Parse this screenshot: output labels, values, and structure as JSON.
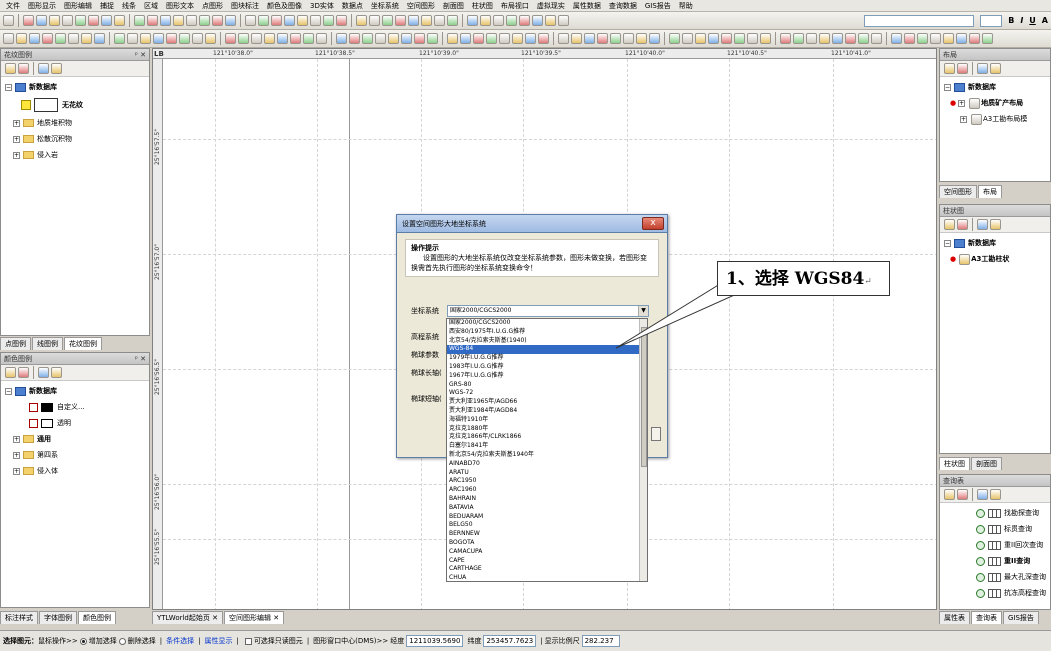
{
  "menu": [
    "文件",
    "图形显示",
    "图形编辑",
    "捕捉",
    "线条",
    "区域",
    "图形文本",
    "点图形",
    "图块标注",
    "颜色及图像",
    "3D实体",
    "数据点",
    "坐标系统",
    "空间图形",
    "剖面图",
    "柱状图",
    "布局视口",
    "虚拟现实",
    "属性数据",
    "查询数据",
    "GIS报告",
    "帮助"
  ],
  "format_toolbar": {
    "bold": "B",
    "italic": "I",
    "underline": "U",
    "font_color": "A"
  },
  "left_top_panel": {
    "title": "花纹图例",
    "root": "新数据库",
    "swatch_label": "无花纹",
    "folders": [
      "地质堆积物",
      "松散沉积物",
      "侵入岩"
    ],
    "tabs": [
      "点图例",
      "线图例",
      "花纹图例"
    ]
  },
  "left_bottom_panel": {
    "title": "颜色图例",
    "root": "新数据库",
    "items": [
      "自定义...",
      "透明"
    ],
    "folders": [
      "通用",
      "第四系",
      "侵入体"
    ],
    "tabs": [
      "标注样式",
      "字体图例",
      "颜色图例"
    ]
  },
  "doc_tabs": [
    "YTLWorld起始页",
    "空间图形编辑"
  ],
  "ruler_top": [
    "121°10'38.0\"",
    "121°10'38.5\"",
    "121°10'39.0\"",
    "121°10'39.5\"",
    "121°10'40.0\"",
    "121°10'40.5\"",
    "121°10'41.0\""
  ],
  "ruler_left": [
    "25°16'57.5\"",
    "25°16'57.0\"",
    "25°16'56.5\"",
    "25°16'56.0\"",
    "25°16'55.5\"",
    "25°16'55.0\""
  ],
  "corner_label": "LB",
  "dialog": {
    "title": "设置空间图形大地坐标系统",
    "close": "x",
    "hint_title": "操作提示",
    "hint_text": "设置图形的大地坐标系统仅改变坐标系统参数，图形未做变换，若图形变换需首先执行图形的坐标系统变换命令！",
    "labels": [
      "坐标系统",
      "高程系统",
      "椭球参数",
      "椭球长轴(",
      "椭球短轴("
    ],
    "selected": "国家2000/CGCS2000",
    "options": [
      "国家2000/CGCS2000",
      "西安80/1975年I.U.G.G推荐",
      "北京54/克拉索夫斯基(1940)",
      "WGS-84",
      "1979年I.U.G.G推荐",
      "1983年I.U.G.G推荐",
      "1967年I.U.G.G推荐",
      "GRS-80",
      "WGS-72",
      "贾大利亚1965年/AGD66",
      "贾大利亚1984年/AGD84",
      "海福特1910年",
      "克拉克1880年",
      "克拉克1866年/CLRK1866",
      "白塞尔1841年",
      "新北京54/克拉索夫斯基1940年",
      "AINABD70",
      "ARATU",
      "ARC1950",
      "ARC1960",
      "BAHRAIN",
      "BATAVIA",
      "BEDUARAM",
      "BELG50",
      "BERNNEW",
      "BOGOTA",
      "CAMACUPA",
      "CAPE",
      "CARTHAGE",
      "CHUA"
    ],
    "highlighted_index": 3
  },
  "callout": "1、选择 WGS84",
  "right_top_panel": {
    "title": "布局",
    "root": "新数据库",
    "items": [
      "地质矿产布局",
      "A3工勘布局模"
    ],
    "tabs": [
      "空间图形",
      "布局"
    ]
  },
  "right_mid_panel": {
    "title": "柱状图",
    "root": "新数据库",
    "items": [
      "A3工勘柱状"
    ],
    "tabs": [
      "柱状图",
      "剖面图"
    ]
  },
  "right_bottom_panel": {
    "title": "查询表",
    "items": [
      "找勘探查询",
      "标贯查询",
      "重II回次查询",
      "重II查询",
      "最大孔深查询",
      "抗冻高程查询"
    ],
    "tabs": [
      "属性表",
      "查询表",
      "GIS报告"
    ]
  },
  "status": {
    "select_label": "选择图元：",
    "mouse_op": "鼠标操作>>",
    "add_select": "增加选择",
    "del_select": "删除选择",
    "cond_select": "条件选择",
    "attr_show": "属性显示",
    "only_select": "可选择只读图元",
    "center_label": "图形窗口中心(DMS)>>",
    "lon_label": "经度",
    "lon": "1211039.5690",
    "lat_label": "纬度",
    "lat": "253457.7623",
    "scale_label": "显示比例尺",
    "scale": "282.237"
  }
}
